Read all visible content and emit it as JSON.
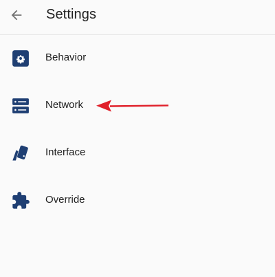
{
  "header": {
    "title": "Settings",
    "back_icon": "arrow-left-icon"
  },
  "menu": {
    "items": [
      {
        "label": "Behavior",
        "icon": "gear-icon"
      },
      {
        "label": "Network",
        "icon": "server-icon"
      },
      {
        "label": "Interface",
        "icon": "palette-swatch-icon"
      },
      {
        "label": "Override",
        "icon": "puzzle-icon"
      }
    ]
  },
  "colors": {
    "icon_blue": "#1f3f73",
    "annotation_red": "#e0202a",
    "text": "#212121",
    "background": "#fafafa"
  },
  "annotation": {
    "type": "arrow",
    "points_to": "Network"
  }
}
